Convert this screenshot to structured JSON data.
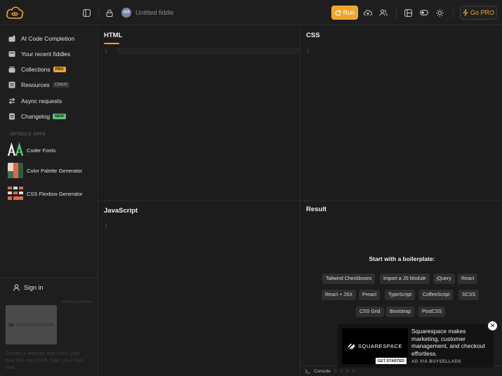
{
  "topbar": {
    "avatar_initials": "AH",
    "fiddle_title": "Untitled fiddle",
    "run_label": "Run",
    "gopro_label": "Go PRO",
    "accent_color": "#f0a52a"
  },
  "sidebar": {
    "items": [
      {
        "label": "AI Code Completion",
        "icon": "ai-icon"
      },
      {
        "label": "Your recent fiddles",
        "icon": "recent-icon"
      },
      {
        "label": "Collections",
        "icon": "collections-icon",
        "badge": "PRO"
      },
      {
        "label": "Resources",
        "icon": "resources-icon",
        "badge": "CDNJS"
      },
      {
        "label": "Async requests",
        "icon": "async-icon"
      },
      {
        "label": "Changelog",
        "icon": "changelog-icon",
        "badge": "NEW"
      }
    ],
    "apps_section_label": "JSFIDDLE APPS",
    "apps": [
      {
        "label": "Coder Fonts"
      },
      {
        "label": "Color Palette Generator"
      },
      {
        "label": "CSS Flexbox Generator"
      }
    ],
    "signin_label": "Sign in",
    "ad": {
      "hide_label": "hide the preview",
      "brand": "SQUARESPACE",
      "text": "Create a website that turns your practice into profit. Start your free trial."
    }
  },
  "panels": {
    "html": {
      "title": "HTML",
      "line": "1"
    },
    "css": {
      "title": "CSS",
      "line": "1"
    },
    "js": {
      "title": "JavaScript",
      "line": "1"
    },
    "result": {
      "title": "Result"
    }
  },
  "boilerplate": {
    "title": "Start with a boilerplate:",
    "chips": [
      "Tailwind Checkboxes",
      "Import a JS Module",
      "jQuery",
      "React",
      "React + JSX",
      "Preact",
      "TypeScript",
      "CoffeeScript",
      "SCSS",
      "CSS Grid",
      "Bootstrap",
      "PostCSS"
    ]
  },
  "console": {
    "label": "Console",
    "counts": [
      "0",
      "0",
      "0",
      "0"
    ]
  },
  "float_ad": {
    "brand": "SQUARESPACE",
    "cta": "GET STARTED",
    "text": "Squarespace makes marketing, customer management, and checkout effortless.",
    "via": "AD VIA BUYSELLADS",
    "close": "✕"
  }
}
